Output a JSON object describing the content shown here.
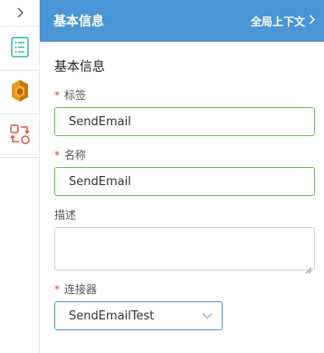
{
  "rail": {
    "items": [
      {
        "icon": "collapse-chevron-icon"
      },
      {
        "icon": "list-document-icon",
        "active": true
      },
      {
        "icon": "amazon-ses-icon"
      },
      {
        "icon": "swap-convert-icon"
      }
    ]
  },
  "header": {
    "title": "基本信息",
    "link": "全局上下文"
  },
  "form": {
    "section_title": "基本信息",
    "tag": {
      "label": "标签",
      "required": "*",
      "value": "SendEmail"
    },
    "name": {
      "label": "名称",
      "required": "*",
      "value": "SendEmail"
    },
    "description": {
      "label": "描述",
      "value": ""
    },
    "connector": {
      "label": "连接器",
      "required": "*",
      "value": "SendEmailTest"
    }
  },
  "colors": {
    "header_bg": "#4a96d6",
    "valid_border": "#6cbd58",
    "focus_border": "#4a96d6",
    "required": "#e04a3c"
  }
}
